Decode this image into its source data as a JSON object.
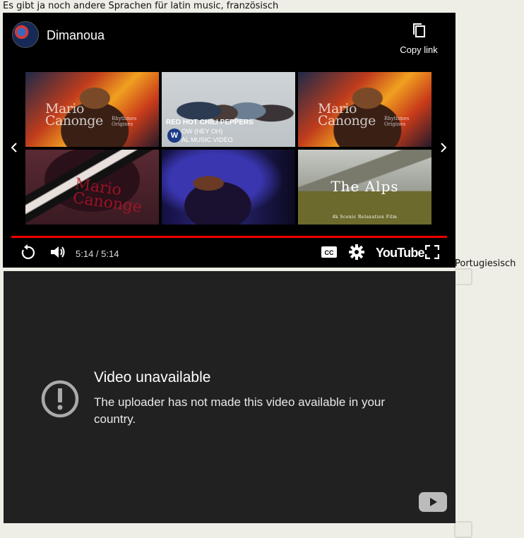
{
  "post": {
    "text": "Es gibt ja noch andere Sprachen für latin music, französisch",
    "side_text": "Portugiesisch"
  },
  "player1": {
    "channel_name": "Dimanoua",
    "copy_link_label": "Copy link",
    "time": "5:14 / 5:14",
    "progress_percent": 100,
    "brand": "YouTube",
    "thumbnails": {
      "mario1": {
        "title": "Mario\nCanonge",
        "sub": "Rhythmes\nOrigines"
      },
      "rhcp": {
        "line1": "RED HOT CHILI PEPPERS",
        "line2": "OW (HEY OH)",
        "line3": "AL MUSIC VIDEO",
        "badge": "W"
      },
      "mario2": {
        "title": "Mario\nCanonge",
        "sub": "Rhythmes\nOrigines"
      },
      "alps": {
        "title": "The Alps",
        "sub": "4k Scenic Relaxation Film"
      }
    }
  },
  "player2": {
    "title": "Video unavailable",
    "message": "The uploader has not made this video available in your country."
  }
}
